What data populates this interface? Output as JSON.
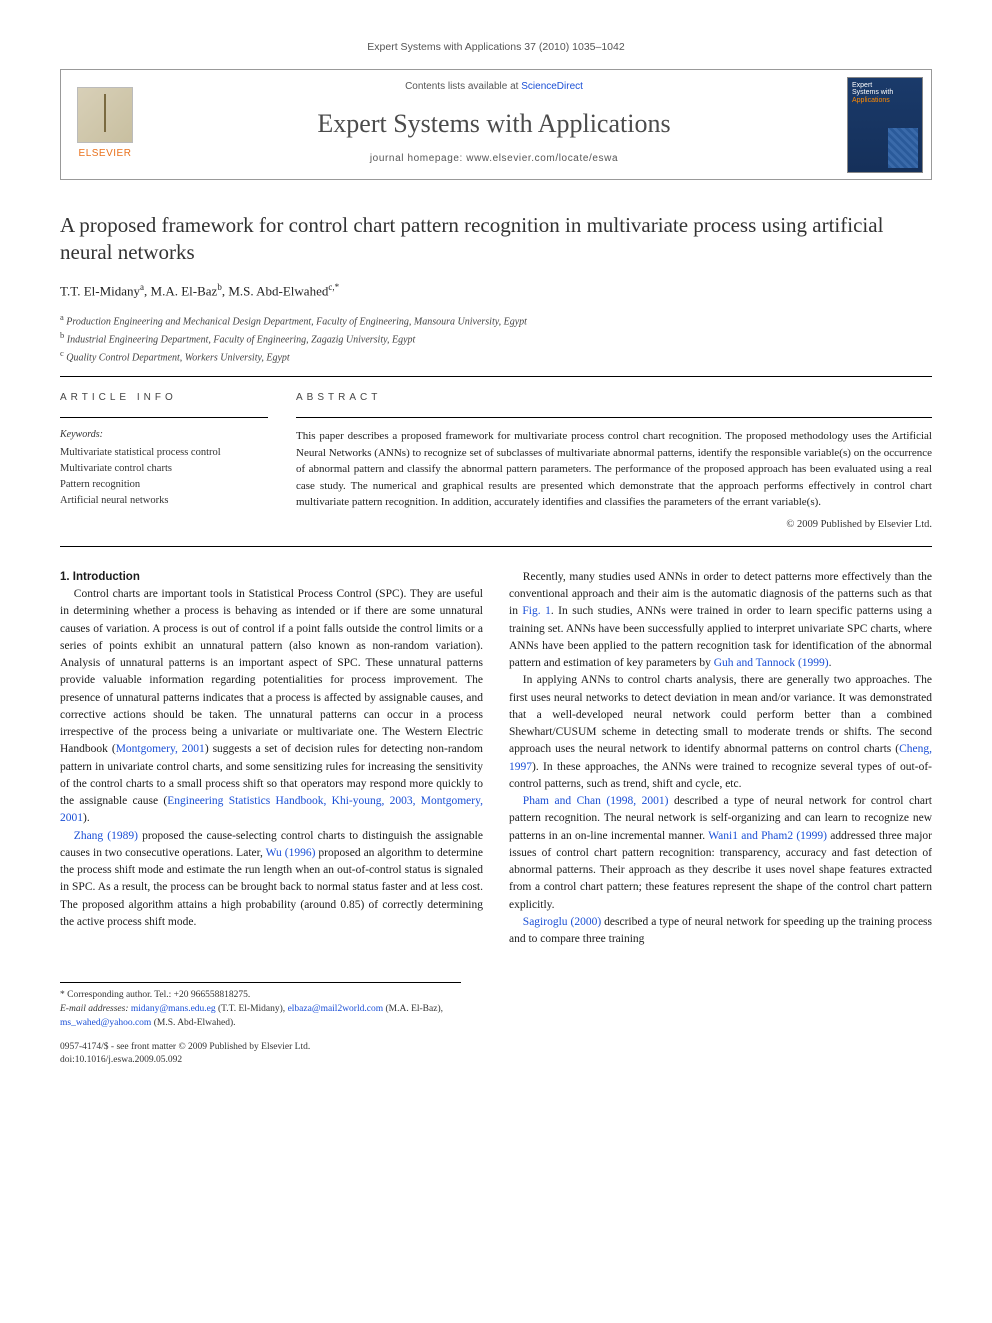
{
  "running_head": "Expert Systems with Applications 37 (2010) 1035–1042",
  "masthead": {
    "contents_prefix": "Contents lists available at ",
    "contents_link": "ScienceDirect",
    "journal_name": "Expert Systems with Applications",
    "homepage_prefix": "journal homepage: ",
    "homepage_url": "www.elsevier.com/locate/eswa",
    "publisher": "ELSEVIER",
    "cover_line1": "Expert",
    "cover_line2": "Systems with",
    "cover_line3": "Applications"
  },
  "title": "A proposed framework for control chart pattern recognition in multivariate process using artificial neural networks",
  "authors_html": {
    "a1_name": "T.T. El-Midany",
    "a1_mark": "a",
    "a2_name": "M.A. El-Baz",
    "a2_mark": "b",
    "a3_name": "M.S. Abd-Elwahed",
    "a3_mark": "c,",
    "corr_mark": "*"
  },
  "affiliations": {
    "a": "Production Engineering and Mechanical Design Department, Faculty of Engineering, Mansoura University, Egypt",
    "b": "Industrial Engineering Department, Faculty of Engineering, Zagazig University, Egypt",
    "c": "Quality Control Department, Workers University, Egypt"
  },
  "info": {
    "head": "ARTICLE INFO",
    "keywords_head": "Keywords:",
    "keywords": [
      "Multivariate statistical process control",
      "Multivariate control charts",
      "Pattern recognition",
      "Artificial neural networks"
    ]
  },
  "abstract": {
    "head": "ABSTRACT",
    "text": "This paper describes a proposed framework for multivariate process control chart recognition. The proposed methodology uses the Artificial Neural Networks (ANNs) to recognize set of subclasses of multivariate abnormal patterns, identify the responsible variable(s) on the occurrence of abnormal pattern and classify the abnormal pattern parameters. The performance of the proposed approach has been evaluated using a real case study. The numerical and graphical results are presented which demonstrate that the approach performs effectively in control chart multivariate pattern recognition. In addition, accurately identifies and classifies the parameters of the errant variable(s).",
    "copyright": "© 2009 Published by Elsevier Ltd."
  },
  "section1_head": "1. Introduction",
  "body": {
    "p1": "Control charts are important tools in Statistical Process Control (SPC). They are useful in determining whether a process is behaving as intended or if there are some unnatural causes of variation. A process is out of control if a point falls outside the control limits or a series of points exhibit an unnatural pattern (also known as non-random variation). Analysis of unnatural patterns is an important aspect of SPC. These unnatural patterns provide valuable information regarding potentialities for process improvement. The presence of unnatural patterns indicates that a process is affected by assignable causes, and corrective actions should be taken. The unnatural patterns can occur in a process irrespective of the process being a univariate or multivariate one. The Western Electric Handbook (",
    "p1_cite1": "Montgomery, 2001",
    "p1b": ") suggests a set of decision rules for detecting non-random pattern in univariate control charts, and some sensitizing rules for increasing the sensitivity of the control charts to a small process shift so that operators may respond more quickly to the assignable cause (",
    "p1_cite2": "Engineering Statistics Handbook, Khi-young, 2003, Montgomery, 2001",
    "p1c": ").",
    "p2_cite1": "Zhang (1989)",
    "p2a": " proposed the cause-selecting control charts to distinguish the assignable causes in two consecutive operations. Later, ",
    "p2_cite2": "Wu (1996)",
    "p2b": " proposed an algorithm to determine the process shift mode and estimate the run length when an out-of-control status is signaled in SPC. As a result, the process can be brought back to normal status faster and at less cost. The proposed algorithm at",
    "p2c": "tains a high probability (around 0.85) of correctly determining the active process shift mode.",
    "p3a": "Recently, many studies used ANNs in order to detect patterns more effectively than the conventional approach and their aim is the automatic diagnosis of the patterns such as that in ",
    "p3_fig": "Fig. 1",
    "p3b": ". In such studies, ANNs were trained in order to learn specific patterns using a training set. ANNs have been successfully applied to interpret univariate SPC charts, where ANNs have been applied to the pattern recognition task for identification of the abnormal pattern and estimation of key parameters by ",
    "p3_cite1": "Guh and Tannock (1999)",
    "p3c": ".",
    "p4a": "In applying ANNs to control charts analysis, there are generally two approaches. The first uses neural networks to detect deviation in mean and/or variance. It was demonstrated that a well-developed neural network could perform better than a combined Shewhart/CUSUM scheme in detecting small to moderate trends or shifts. The second approach uses the neural network to identify abnormal patterns on control charts (",
    "p4_cite1": "Cheng, 1997",
    "p4b": "). In these approaches, the ANNs were trained to recognize several types of out-of-control patterns, such as trend, shift and cycle, etc.",
    "p5_cite1": "Pham and Chan (1998, 2001)",
    "p5a": " described a type of neural network for control chart pattern recognition. The neural network is self-organizing and can learn to recognize new patterns in an on-line incremental manner. ",
    "p5_cite2": "Wani1 and Pham2 (1999)",
    "p5b": " addressed three major issues of control chart pattern recognition: transparency, accuracy and fast detection of abnormal patterns. Their approach as they describe it uses novel shape features extracted from a control chart pattern; these features represent the shape of the control chart pattern explicitly.",
    "p6_cite1": "Sagiroglu (2000)",
    "p6a": " described a type of neural network for speeding up the training process and to compare three training"
  },
  "footnotes": {
    "corr": "* Corresponding author. Tel.: +20 966558818275.",
    "emails_label": "E-mail addresses:",
    "e1": "midany@mans.edu.eg",
    "e1_who": " (T.T. El-Midany), ",
    "e2": "elbaza@mail2world.com",
    "e2_who": " (M.A. El-Baz), ",
    "e3": "ms_wahed@yahoo.com",
    "e3_who": " (M.S. Abd-Elwahed)."
  },
  "pubfoot": {
    "issn_line": "0957-4174/$ - see front matter © 2009 Published by Elsevier Ltd.",
    "doi_line": "doi:10.1016/j.eswa.2009.05.092"
  }
}
